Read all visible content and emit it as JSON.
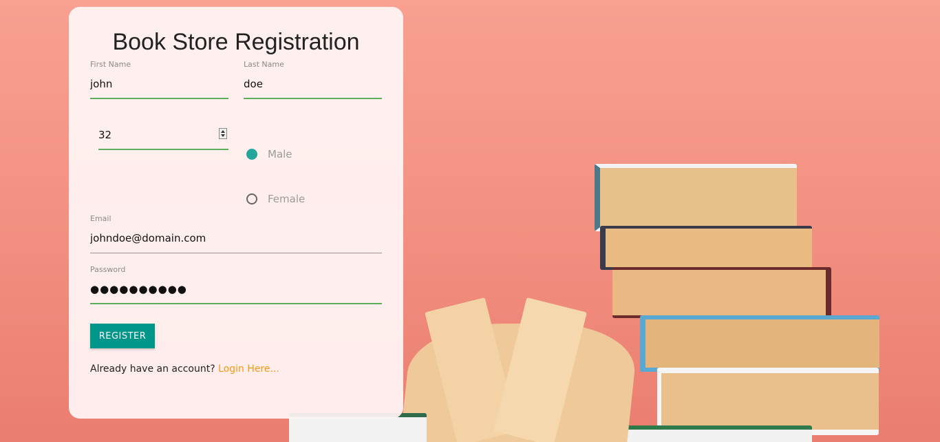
{
  "form": {
    "title": "Book Store Registration",
    "first_name": {
      "label": "First Name",
      "value": "john"
    },
    "last_name": {
      "label": "Last Name",
      "value": "doe"
    },
    "age": {
      "value": "32"
    },
    "gender": {
      "options": [
        {
          "label": "Male",
          "selected": true
        },
        {
          "label": "Female",
          "selected": false
        }
      ]
    },
    "email": {
      "label": "Email",
      "value": "johndoe@domain.com"
    },
    "password": {
      "label": "Password",
      "value": "●●●●●●●●●●"
    },
    "register_label": "REGISTER",
    "footer_text": "Already have an account?",
    "login_link": "Login Here..."
  },
  "colors": {
    "accent": "#00968a",
    "radio_on": "#26a69a",
    "link": "#f39c12",
    "underline": "#5aaf5a",
    "background": "#f39283"
  }
}
